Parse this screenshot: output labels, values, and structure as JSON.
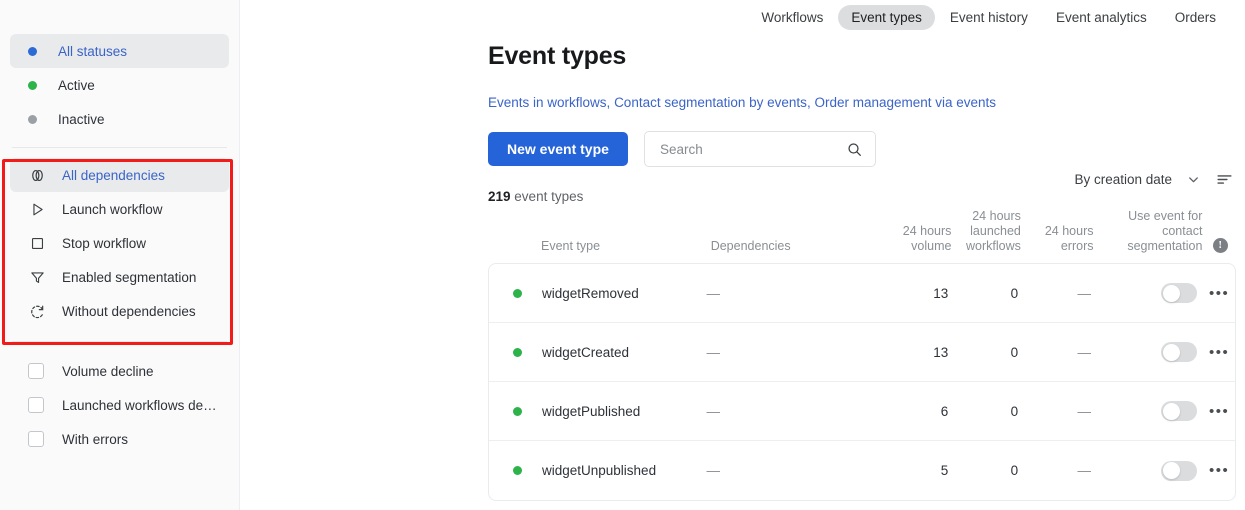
{
  "topnav": {
    "tabs": [
      {
        "label": "Workflows",
        "active": false
      },
      {
        "label": "Event types",
        "active": true
      },
      {
        "label": "Event history",
        "active": false
      },
      {
        "label": "Event analytics",
        "active": false
      },
      {
        "label": "Orders",
        "active": false
      }
    ]
  },
  "sidebar": {
    "statuses": [
      {
        "label": "All statuses",
        "dot": "#2c6ad4",
        "selected": true
      },
      {
        "label": "Active",
        "dot": "#2cb34a",
        "selected": false
      },
      {
        "label": "Inactive",
        "dot": "#9aa0a6",
        "selected": false
      }
    ],
    "dependencies": [
      {
        "label": "All dependencies",
        "icon": "link-icon",
        "selected": true
      },
      {
        "label": "Launch workflow",
        "icon": "play-icon",
        "selected": false
      },
      {
        "label": "Stop workflow",
        "icon": "stop-square-icon",
        "selected": false
      },
      {
        "label": "Enabled segmentation",
        "icon": "funnel-icon",
        "selected": false
      },
      {
        "label": "Without dependencies",
        "icon": "dashed-refresh-icon",
        "selected": false
      }
    ],
    "checkboxes": [
      {
        "label": "Volume decline",
        "checked": false
      },
      {
        "label": "Launched workflows de…",
        "checked": false
      },
      {
        "label": "With errors",
        "checked": false
      }
    ]
  },
  "page": {
    "title": "Event types",
    "sublinks": [
      "Events in workflows",
      "Contact segmentation by events",
      "Order management via events"
    ],
    "sublink_separator": ", "
  },
  "toolbar": {
    "new_event_type_label": "New event type",
    "search_placeholder": "Search",
    "search_value": "",
    "search_icon": "search-icon"
  },
  "count": {
    "number": "219",
    "label": "event types"
  },
  "sort": {
    "label": "By creation date",
    "chevron_icon": "chevron-down-icon",
    "order_icon": "sort-order-icon"
  },
  "table": {
    "headers": {
      "event_type": "Event type",
      "dependencies": "Dependencies",
      "volume": [
        "24 hours",
        "volume"
      ],
      "launched_workflows": [
        "24 hours",
        "launched",
        "workflows"
      ],
      "errors": [
        "24 hours",
        "errors"
      ],
      "segmentation": [
        "Use event for",
        "contact",
        "segmentation"
      ],
      "info_icon": "info-icon",
      "info_glyph": "!"
    },
    "rows": [
      {
        "status_dot": "#2cb34a",
        "name": "widgetRemoved",
        "dependencies": "—",
        "volume": "13",
        "launched_workflows": "0",
        "errors": "—",
        "segmentation_on": false,
        "menu_icon": "more-options-icon",
        "menu_glyph": "•••"
      },
      {
        "status_dot": "#2cb34a",
        "name": "widgetCreated",
        "dependencies": "—",
        "volume": "13",
        "launched_workflows": "0",
        "errors": "—",
        "segmentation_on": false,
        "menu_icon": "more-options-icon",
        "menu_glyph": "•••"
      },
      {
        "status_dot": "#2cb34a",
        "name": "widgetPublished",
        "dependencies": "—",
        "volume": "6",
        "launched_workflows": "0",
        "errors": "—",
        "segmentation_on": false,
        "menu_icon": "more-options-icon",
        "menu_glyph": "•••"
      },
      {
        "status_dot": "#2cb34a",
        "name": "widgetUnpublished",
        "dependencies": "—",
        "volume": "5",
        "launched_workflows": "0",
        "errors": "—",
        "segmentation_on": false,
        "menu_icon": "more-options-icon",
        "menu_glyph": "•••"
      }
    ]
  },
  "annotation": {
    "highlight_color": "#f31a1a",
    "target": "dependencies-filter-group"
  },
  "colors": {
    "primary_button": "#2563d9",
    "link": "#3a64c8",
    "active_dot": "#2cb34a",
    "all_dot": "#2c6ad4",
    "inactive_dot": "#9aa0a6"
  }
}
